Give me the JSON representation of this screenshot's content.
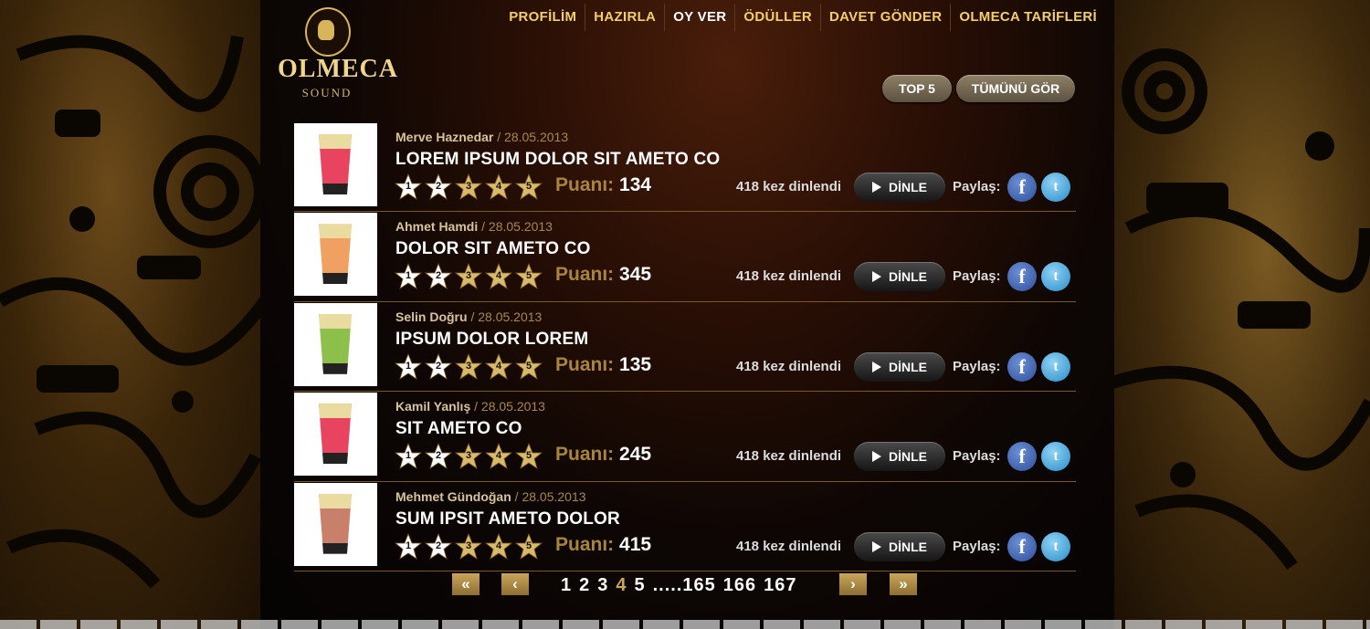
{
  "brand": {
    "name": "OLMECA",
    "sub": "SOUND"
  },
  "nav": [
    {
      "label": "PROFİLİM",
      "active": false
    },
    {
      "label": "HAZIRLA",
      "active": false
    },
    {
      "label": "OY VER",
      "active": true
    },
    {
      "label": "ÖDÜLLER",
      "active": false
    },
    {
      "label": "DAVET GÖNDER",
      "active": false
    },
    {
      "label": "OLMECA TARİFLERİ",
      "active": false
    }
  ],
  "filters": {
    "top5": "TOP 5",
    "all": "TÜMÜNÜ GÖR"
  },
  "labels": {
    "score": "Puanı:",
    "plays_suffix": "kez dinlendi",
    "listen": "DİNLE",
    "share": "Paylaş:"
  },
  "stars": [
    "1",
    "2",
    "3",
    "4",
    "5"
  ],
  "items": [
    {
      "user": "Merve Haznedar",
      "date": "/ 28.05.2013",
      "title": "LOREM IPSUM DOLOR SIT AMETO CO",
      "score": "134",
      "plays": "418",
      "rating": 2,
      "cup_color": "#e8435f"
    },
    {
      "user": "Ahmet Hamdi",
      "date": "/ 28.05.2013",
      "title": "DOLOR SIT AMETO CO",
      "score": "345",
      "plays": "418",
      "rating": 2,
      "cup_color": "#f0a060"
    },
    {
      "user": "Selin Doğru",
      "date": "/ 28.05.2013",
      "title": "IPSUM DOLOR LOREM",
      "score": "135",
      "plays": "418",
      "rating": 2,
      "cup_color": "#8cc04a"
    },
    {
      "user": "Kamil Yanlış",
      "date": "/ 28.05.2013",
      "title": "SIT AMETO CO",
      "score": "245",
      "plays": "418",
      "rating": 2,
      "cup_color": "#e8435f"
    },
    {
      "user": "Mehmet Gündoğan",
      "date": "/ 28.05.2013",
      "title": "SUM IPSIT AMETO DOLOR",
      "score": "415",
      "plays": "418",
      "rating": 2,
      "cup_color": "#c9806a"
    }
  ],
  "pagination": {
    "first": "«",
    "prev": "‹",
    "next": "›",
    "last": "»",
    "pages": [
      "1",
      "2",
      "3",
      "4",
      "5",
      ".....",
      "165",
      "166",
      "167"
    ],
    "current": "4"
  },
  "colors": {
    "accent": "#f2cf6a",
    "gold": "#c9a45a",
    "divider": "#7a5a24"
  }
}
